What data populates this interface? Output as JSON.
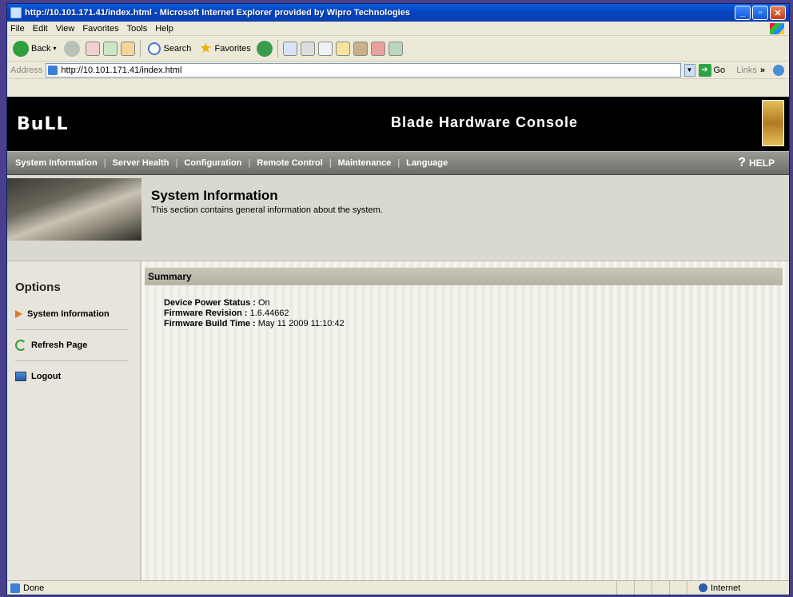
{
  "browser": {
    "title": "http://10.101.171.41/index.html - Microsoft Internet Explorer provided by Wipro Technologies",
    "menu": [
      "File",
      "Edit",
      "View",
      "Favorites",
      "Tools",
      "Help"
    ],
    "toolbar": {
      "back": "Back",
      "search": "Search",
      "favorites": "Favorites"
    },
    "address_label": "Address",
    "address_value": "http://10.101.171.41/index.html",
    "go_label": "Go",
    "links_label": "Links",
    "links_chevron": "»",
    "status_text": "Done",
    "zone_text": "Internet"
  },
  "app": {
    "logo": "BuLL",
    "console_title": "Blade Hardware Console",
    "nav": [
      "System Information",
      "Server Health",
      "Configuration",
      "Remote Control",
      "Maintenance",
      "Language"
    ],
    "help_label": "HELP",
    "help_glyph": "?",
    "section_title": "System Information",
    "section_subtitle": "This section contains general information about the system."
  },
  "sidebar": {
    "heading": "Options",
    "items": [
      "System Information",
      "Refresh Page",
      "Logout"
    ]
  },
  "summary": {
    "title": "Summary",
    "rows": [
      {
        "label": "Device Power Status :",
        "value": "On"
      },
      {
        "label": "Firmware Revision :",
        "value": "1.6.44662"
      },
      {
        "label": "Firmware Build Time :",
        "value": "May 11 2009 11:10:42"
      }
    ]
  }
}
